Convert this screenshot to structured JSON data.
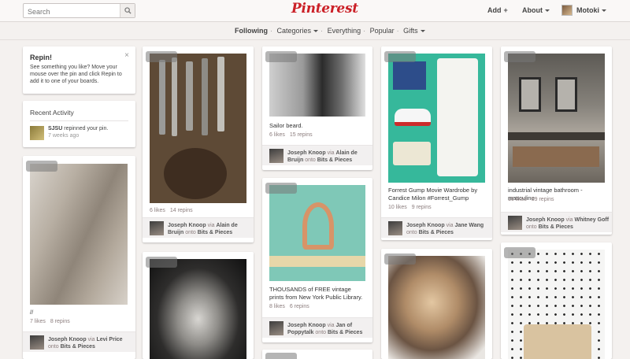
{
  "header": {
    "search_placeholder": "Search",
    "logo": "Pinterest",
    "add_label": "Add",
    "about_label": "About",
    "user_name": "Motoki"
  },
  "subnav": {
    "following": "Following",
    "categories": "Categories",
    "everything": "Everything",
    "popular": "Popular",
    "gifts": "Gifts"
  },
  "sidebar": {
    "repin_title": "Repin!",
    "repin_text": "See something you like? Move your mouse over the pin and click Repin to add it to one of your boards.",
    "activity_title": "Recent Activity",
    "activity_user": "SJSU",
    "activity_action": "repinned your pin.",
    "activity_time": "7 weeks ago"
  },
  "pins": [
    {
      "desc": "//",
      "likes": "7 likes",
      "repins": "8 repins",
      "pinner": "Joseph Knoop",
      "via": "via",
      "source": "Levi Price",
      "onto": "onto",
      "board": "Bits & Pieces"
    },
    {
      "desc": "",
      "likes": "6 likes",
      "repins": "14 repins",
      "pinner": "Joseph Knoop",
      "via": "via",
      "source": "Alain de Bruijn",
      "onto": "onto",
      "board": "Bits & Pieces"
    },
    {
      "desc": "Sailor beard.",
      "likes": "6 likes",
      "repins": "15 repins",
      "pinner": "Joseph Knoop",
      "via": "via",
      "source": "Alain de Bruijn",
      "onto": "onto",
      "board": "Bits & Pieces"
    },
    {
      "desc": "THOUSANDS of FREE vintage prints from New York Public Library.",
      "likes": "8 likes",
      "repins": "6 repins",
      "pinner": "Joseph Knoop",
      "via": "via",
      "source": "Jan of Poppytalk",
      "onto": "onto",
      "board": "Bits & Pieces"
    },
    {
      "desc": "Forrest Gump Movie Wardrobe by Candice Milon #Forrest_Gump",
      "likes": "10 likes",
      "repins": "9 repins",
      "pinner": "Joseph Knoop",
      "via": "via",
      "source": "Jane Wang",
      "onto": "onto",
      "board": "Bits & Pieces"
    },
    {
      "desc": "industrial vintage bathroom - masculine",
      "likes": "16 likes",
      "repins": "59 repins",
      "pinner": "Joseph Knoop",
      "via": "via",
      "source": "Whitney Goff",
      "onto": "onto",
      "board": "Bits & Pieces"
    }
  ],
  "colors": {
    "brand": "#cb2027",
    "background": "#f4f1ef"
  }
}
